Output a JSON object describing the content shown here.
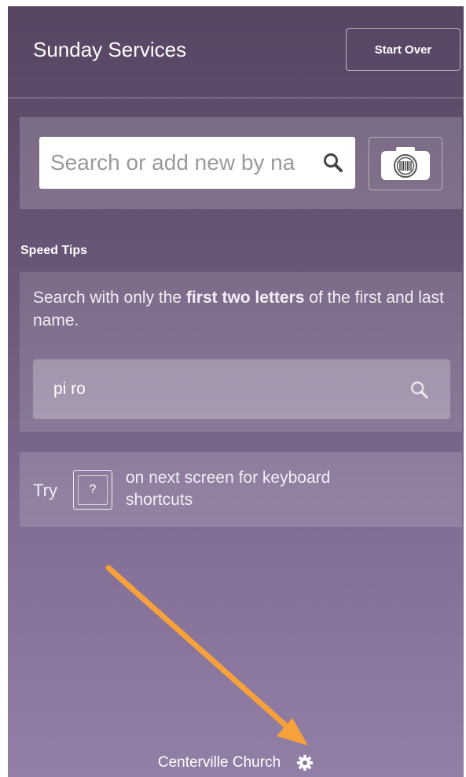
{
  "header": {
    "title": "Sunday Services",
    "start_over_label": "Start Over"
  },
  "search": {
    "placeholder": "Search or add new by na",
    "search_icon": "search-icon",
    "scan_button_icon": "camera-barcode-icon"
  },
  "speed_tips": {
    "heading": "Speed Tips",
    "tip_prefix": "Search with only the ",
    "tip_bold": "first two letters",
    "tip_suffix": " of the first and last name.",
    "example_value": "pi ro"
  },
  "keyboard_tip": {
    "try_label": "Try",
    "key_label": "?",
    "description": "on next screen for keyboard shortcuts"
  },
  "footer": {
    "church_name": "Centerville Church",
    "settings_icon": "gear-icon"
  },
  "annotation": {
    "arrow_color": "#f7a13a"
  },
  "colors": {
    "background_top": "#574562",
    "background_bottom": "#927fa6"
  }
}
